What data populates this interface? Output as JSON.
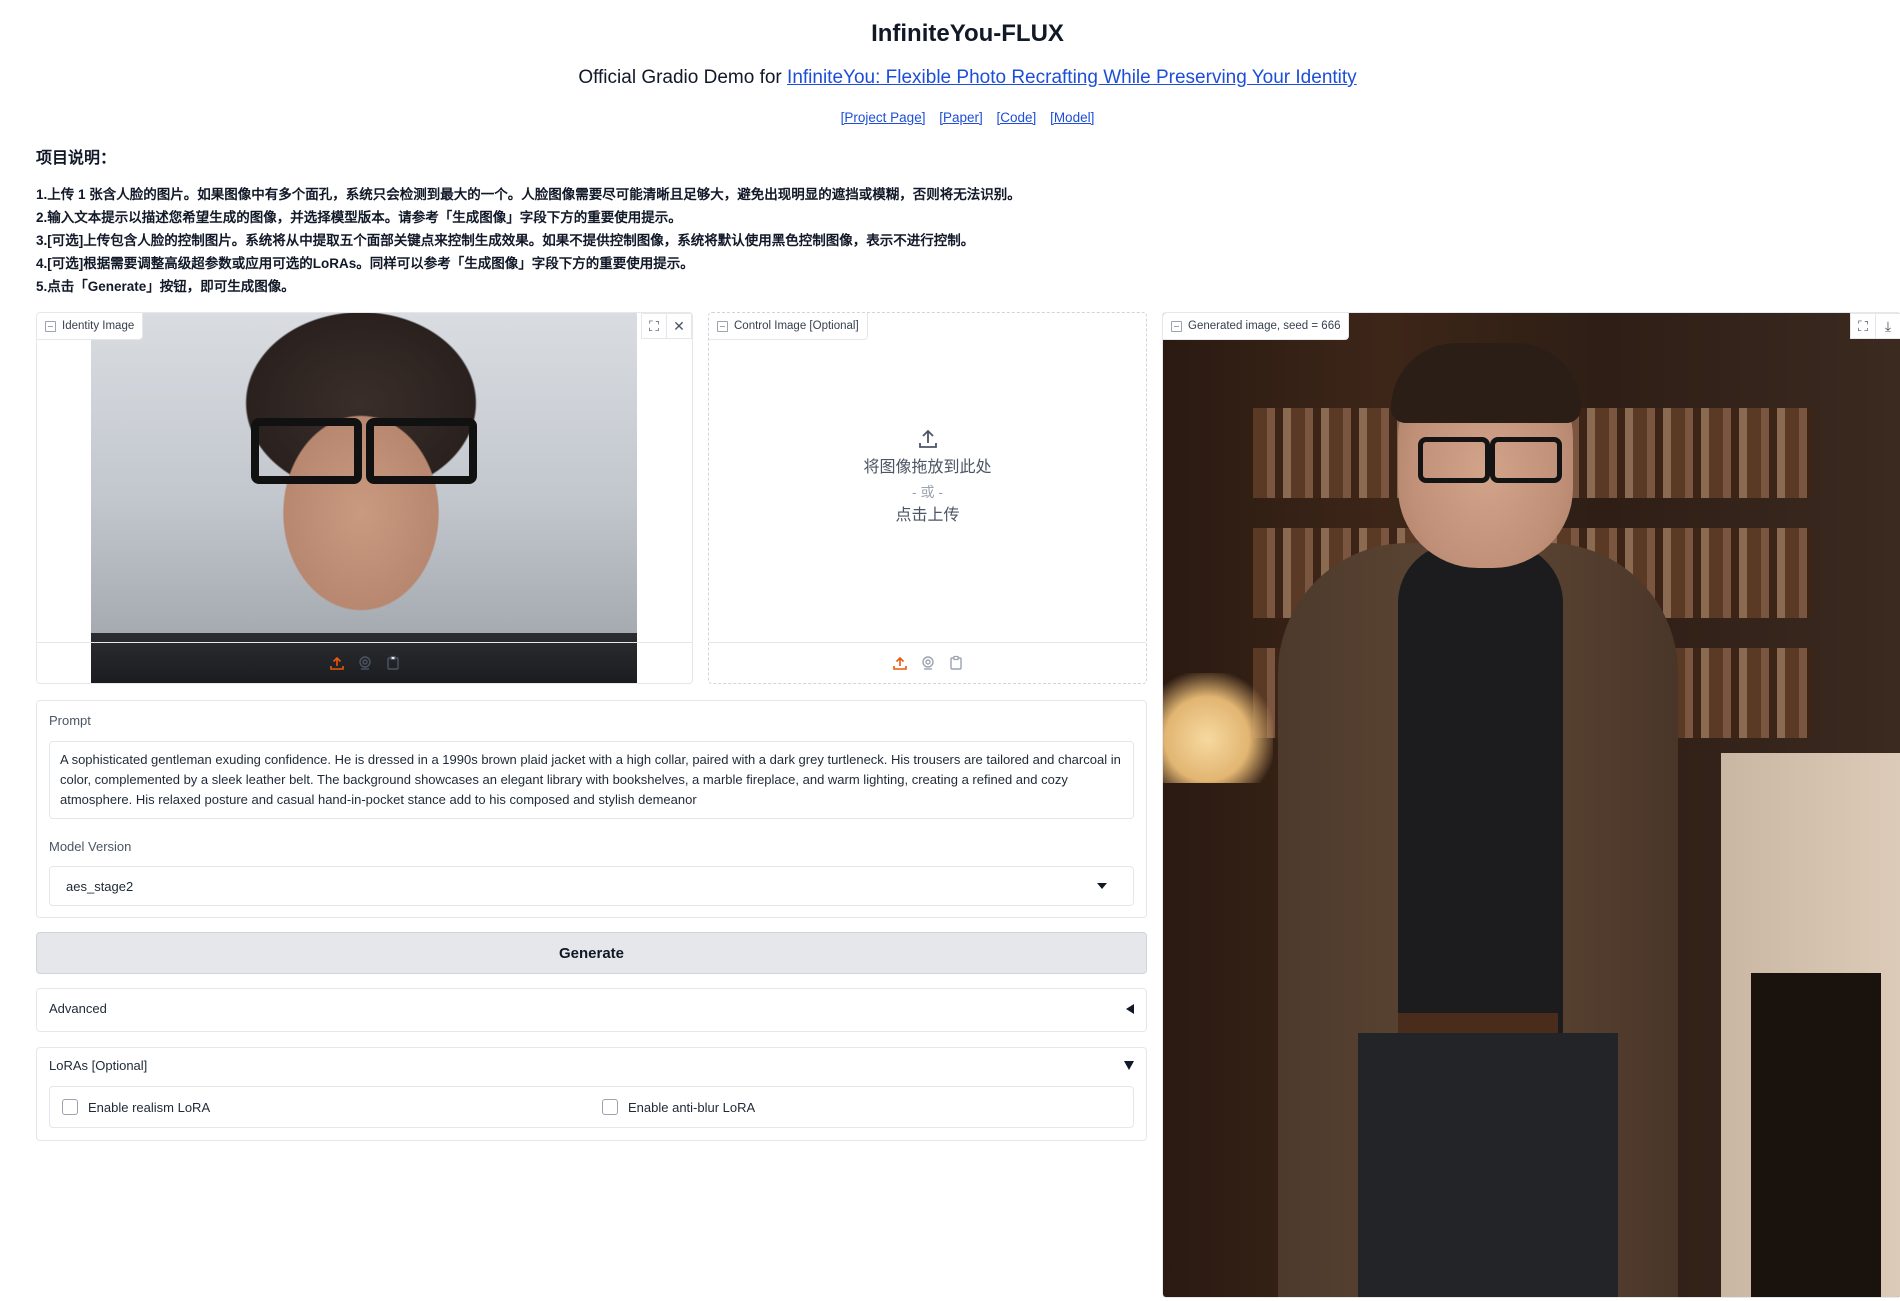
{
  "header": {
    "title": "InfiniteYou-FLUX",
    "subtitle_prefix": "Official Gradio Demo for ",
    "subtitle_link": "InfiniteYou: Flexible Photo Recrafting While Preserving Your Identity",
    "links": [
      "[Project Page]",
      "[Paper]",
      "[Code]",
      "[Model]"
    ]
  },
  "description": {
    "heading": "项目说明：",
    "items": [
      "1.上传 1 张含人脸的图片。如果图像中有多个面孔，系统只会检测到最大的一个。人脸图像需要尽可能清晰且足够大，避免出现明显的遮挡或模糊，否则将无法识别。",
      "2.输入文本提示以描述您希望生成的图像，并选择模型版本。请参考「生成图像」字段下方的重要使用提示。",
      "3.[可选]上传包含人脸的控制图片。系统将从中提取五个面部关键点来控制生成效果。如果不提供控制图像，系统将默认使用黑色控制图像，表示不进行控制。",
      "4.[可选]根据需要调整高级超参数或应用可选的LoRAs。同样可以参考「生成图像」字段下方的重要使用提示。",
      "5.点击「Generate」按钮，即可生成图像。"
    ]
  },
  "identity_image": {
    "label": "Identity Image"
  },
  "control_image": {
    "label": "Control Image [Optional]",
    "drop_text": "将图像拖放到此处",
    "or_text": "- 或 -",
    "click_text": "点击上传"
  },
  "generated_image": {
    "label": "Generated image, seed = 666"
  },
  "prompt": {
    "label": "Prompt",
    "value": "A sophisticated gentleman exuding confidence. He is dressed in a 1990s brown plaid jacket with a high collar, paired with a dark grey turtleneck. His trousers are tailored and charcoal in color, complemented by a sleek leather belt. The background showcases an elegant library with bookshelves, a marble fireplace, and warm lighting, creating a refined and cozy atmosphere. His relaxed posture and casual hand-in-pocket stance add to his composed and stylish demeanor"
  },
  "model_version": {
    "label": "Model Version",
    "selected": "aes_stage2"
  },
  "generate_button": "Generate",
  "advanced": {
    "label": "Advanced"
  },
  "loras": {
    "label": "LoRAs [Optional]",
    "realism": "Enable realism LoRA",
    "anti_blur": "Enable anti-blur LoRA"
  },
  "colors": {
    "link": "#1d4ed8",
    "upload_accent": "#ea580c"
  }
}
